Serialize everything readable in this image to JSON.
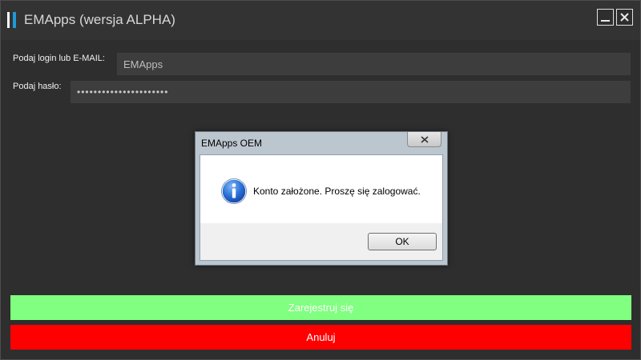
{
  "window": {
    "title": "EMApps (wersja ALPHA)",
    "logo_colors": {
      "bar1": "#ffffff",
      "bar2": "#1e9bd7"
    },
    "minimize_icon": "minimize-icon",
    "close_icon": "close-icon"
  },
  "form": {
    "login_label": "Podaj login lub E-MAIL:",
    "login_value": "EMApps",
    "password_label": "Podaj hasło:",
    "password_value": "••••••••••••••••••••••"
  },
  "actions": {
    "register_label": "Zarejestruj się",
    "register_color": "#80ff80",
    "cancel_label": "Anuluj",
    "cancel_color": "#ff0000"
  },
  "dialog": {
    "title": "EMApps OEM",
    "icon": "info-icon",
    "message": "Konto założone. Proszę się zalogować.",
    "ok_label": "OK"
  }
}
